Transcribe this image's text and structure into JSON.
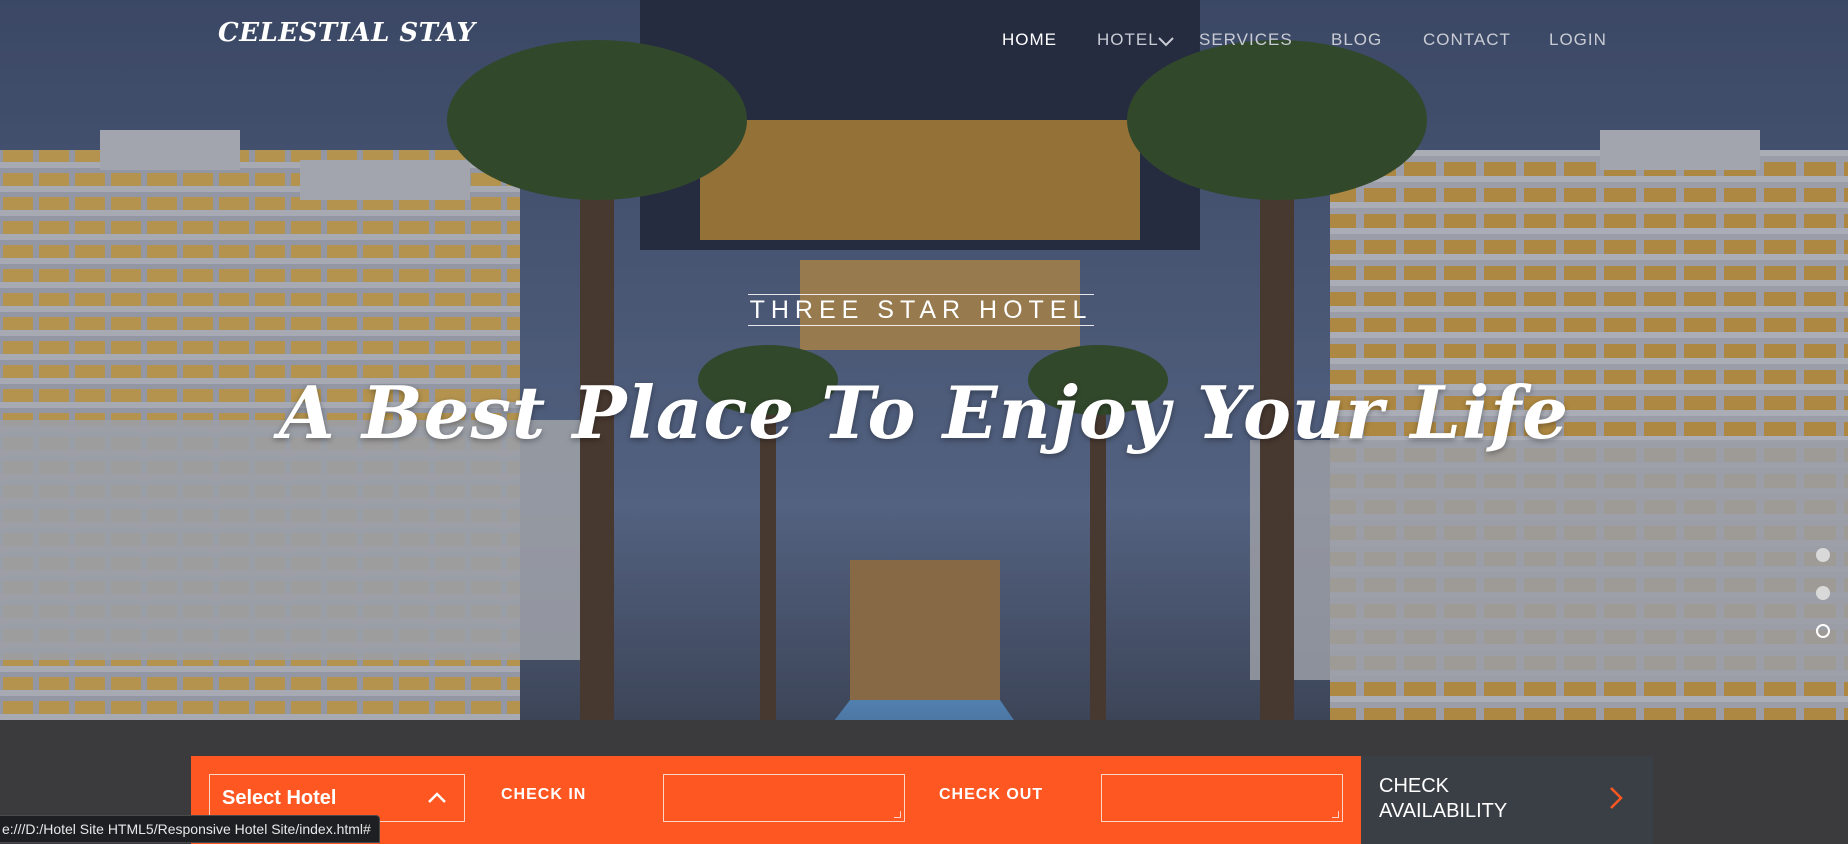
{
  "brand": {
    "name": "CELESTIAL STAY"
  },
  "nav": {
    "items": [
      {
        "label": "HOME",
        "active": true
      },
      {
        "label": "HOTEL",
        "dropdown": true
      },
      {
        "label": "SERVICES"
      },
      {
        "label": "BLOG"
      },
      {
        "label": "CONTACT"
      },
      {
        "label": "LOGIN"
      }
    ]
  },
  "hero": {
    "subtitle": "THREE STAR HOTEL",
    "headline": "A Best Place To Enjoy Your Life",
    "slides": {
      "count": 3,
      "active_index": 2
    }
  },
  "booking": {
    "select_hotel": "Select Hotel",
    "check_in_label": "CHECK IN",
    "check_out_label": "CHECK OUT",
    "check_in_value": "",
    "check_out_value": "",
    "button_line1": "CHECK",
    "button_line2": "AVAILABILITY"
  },
  "status_bar": {
    "url": "e:///D:/Hotel Site HTML5/Responsive Hotel Site/index.html#"
  },
  "colors": {
    "accent": "#ff5722",
    "button": "#3a3f45",
    "nav_inactive": "#c9ccd4"
  },
  "icons": {
    "dropdown": "chevron-down-icon",
    "select": "chevron-up-icon",
    "submit": "chevron-right-icon"
  }
}
